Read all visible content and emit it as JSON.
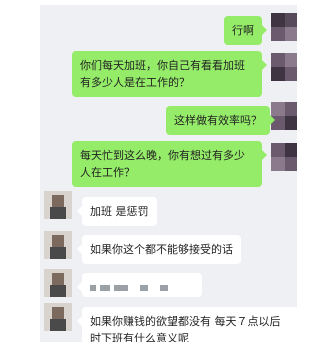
{
  "messages": [
    {
      "direction": "out",
      "text": "行啊"
    },
    {
      "direction": "out",
      "text": "你们每天加班，你自己有看看加班有多少人是在工作的？"
    },
    {
      "direction": "out",
      "text": "这样做有效率吗？"
    },
    {
      "direction": "out",
      "text": "每天忙到这么晚，你有想过有多少人在工作？"
    },
    {
      "direction": "in",
      "text": "加班 是惩罚"
    },
    {
      "direction": "in",
      "text": "如果你这个都不能够接受的话"
    },
    {
      "direction": "in",
      "text": "",
      "redacted": true
    },
    {
      "direction": "in",
      "text": "如果你赚钱的欲望都没有   每天７点以后时下班有什么意义呢"
    }
  ],
  "colors": {
    "outgoing_bubble": "#95ec69",
    "incoming_bubble": "#ffffff",
    "chat_background": "#eef0f3"
  }
}
